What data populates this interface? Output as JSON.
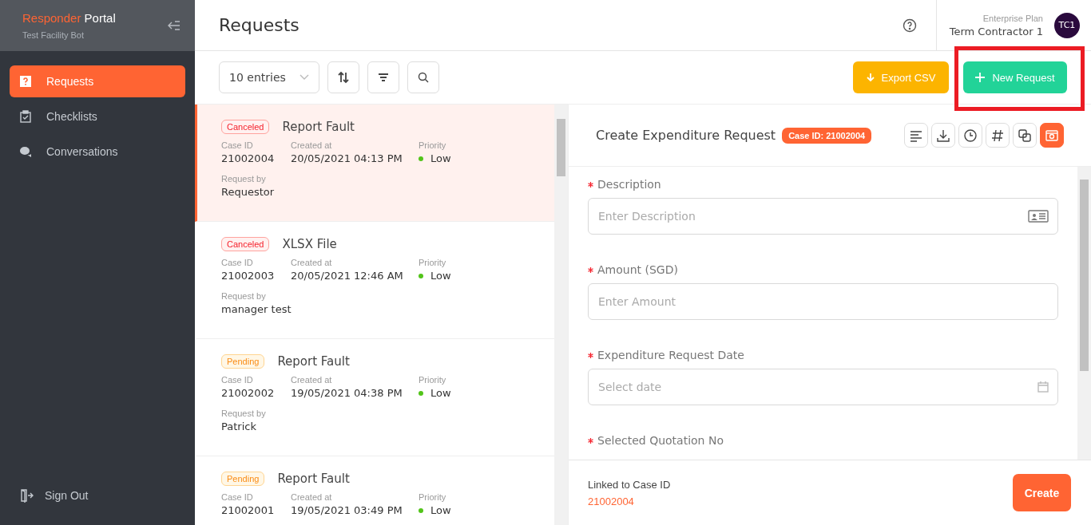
{
  "sidebar": {
    "brand_accent": "Responder",
    "brand_rest": "Portal",
    "subtitle": "Test Facility Bot",
    "items": [
      {
        "label": "Requests",
        "selected": true
      },
      {
        "label": "Checklists",
        "selected": false
      },
      {
        "label": "Conversations",
        "selected": false
      }
    ],
    "sign_out": "Sign Out"
  },
  "header": {
    "title": "Requests",
    "plan": "Enterprise Plan",
    "user": "Term Contractor 1",
    "avatar": "TC1"
  },
  "toolbar": {
    "entries": "10 entries",
    "export": "Export CSV",
    "new_request": {
      "label": "New Request",
      "highlighted": true
    }
  },
  "requests": [
    {
      "status": "Canceled",
      "kind": "canceled",
      "title": "Report Fault",
      "selected": true,
      "case_id_label": "Case ID",
      "case_id": "21002004",
      "created_label": "Created at",
      "created": "20/05/2021 04:13 PM",
      "priority_label": "Priority",
      "priority": "Low",
      "request_by_label": "Request by",
      "request_by": "Requestor"
    },
    {
      "status": "Canceled",
      "kind": "canceled",
      "title": "XLSX File",
      "selected": false,
      "case_id_label": "Case ID",
      "case_id": "21002003",
      "created_label": "Created at",
      "created": "20/05/2021 12:46 AM",
      "priority_label": "Priority",
      "priority": "Low",
      "request_by_label": "Request by",
      "request_by": "manager test"
    },
    {
      "status": "Pending",
      "kind": "pending",
      "title": "Report Fault",
      "selected": false,
      "case_id_label": "Case ID",
      "case_id": "21002002",
      "created_label": "Created at",
      "created": "19/05/2021 04:38 PM",
      "priority_label": "Priority",
      "priority": "Low",
      "request_by_label": "Request by",
      "request_by": "Patrick"
    },
    {
      "status": "Pending",
      "kind": "pending",
      "title": "Report Fault",
      "selected": false,
      "case_id_label": "Case ID",
      "case_id": "21002001",
      "created_label": "Created at",
      "created": "19/05/2021 03:49 PM",
      "priority_label": "Priority",
      "priority": "Low"
    }
  ],
  "detail": {
    "title": "Create Expenditure Request",
    "case_badge": "Case ID: 21002004",
    "tools": [
      {
        "selected": false
      },
      {
        "selected": false
      },
      {
        "selected": false
      },
      {
        "selected": false
      },
      {
        "selected": false
      },
      {
        "selected": true
      }
    ],
    "fields": [
      {
        "label": "Description",
        "required": true,
        "placeholder": "Enter Description",
        "kind": "text"
      },
      {
        "label": "Amount (SGD)",
        "required": true,
        "placeholder": "Enter Amount",
        "kind": "number"
      },
      {
        "label": "Expenditure Request Date",
        "required": true,
        "placeholder": "Select date",
        "kind": "date"
      },
      {
        "label": "Selected Quotation No",
        "required": true
      }
    ],
    "footer": {
      "linked_label": "Linked to Case ID",
      "linked_id": "21002004",
      "create": "Create"
    }
  }
}
